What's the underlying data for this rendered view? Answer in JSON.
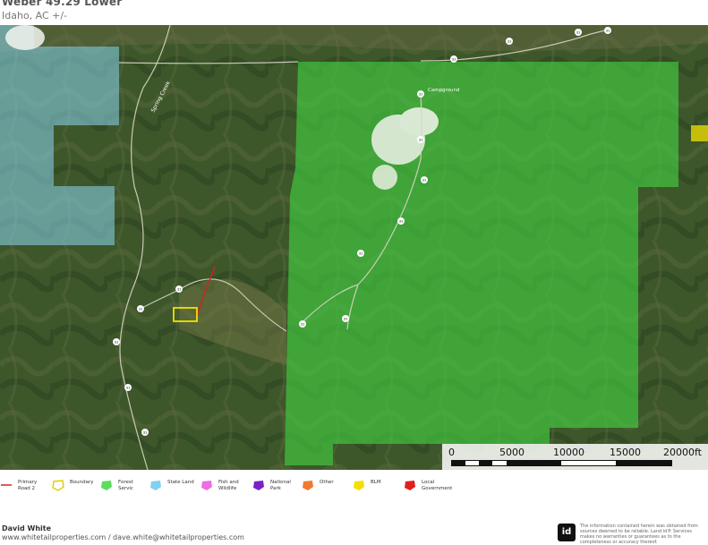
{
  "header": {
    "title": "Weber 49.29 Lower",
    "subtitle": "Idaho,  AC +/-"
  },
  "map": {
    "road_label": "Spring Creek",
    "place_label": "Campground",
    "route_shields": [
      "31",
      "31",
      "31",
      "31",
      "31",
      "31",
      "31",
      "31",
      "31",
      "31",
      "31",
      "31",
      "31",
      "31",
      "31",
      "31"
    ],
    "colors": {
      "forest_service": "#42d442",
      "state_land": "#8ad6f0",
      "boundary": "#f2e200",
      "primary_road": "#d62020",
      "blm": "#f5e000"
    }
  },
  "scale": {
    "labels": [
      "0",
      "5000",
      "10000",
      "15000",
      "20000ft"
    ]
  },
  "legend": [
    {
      "key": "primary-road",
      "label": "Primary Road 2",
      "symbol": "line",
      "color": "#d62020"
    },
    {
      "key": "boundary",
      "label": "Boundary",
      "symbol": "outline",
      "color": "#e6c800"
    },
    {
      "key": "forest-service",
      "label": "Forest Servic",
      "symbol": "pentagon",
      "color": "#5ddc5d"
    },
    {
      "key": "state-land",
      "label": "State Land",
      "symbol": "pentagon",
      "color": "#7fd1ee"
    },
    {
      "key": "fish-wildlife",
      "label": "Fish and Wildlife",
      "symbol": "pentagon",
      "color": "#f06ee0"
    },
    {
      "key": "national-park",
      "label": "National Park",
      "symbol": "pentagon",
      "color": "#7a22c8"
    },
    {
      "key": "other",
      "label": "Other",
      "symbol": "pentagon",
      "color": "#f07a30"
    },
    {
      "key": "blm",
      "label": "BLM",
      "symbol": "pentagon",
      "color": "#f5e000"
    },
    {
      "key": "local-government",
      "label": "Local Government",
      "symbol": "pentagon",
      "color": "#e02020"
    }
  ],
  "footer": {
    "name": "David White",
    "contact": "www.whitetailproperties.com / dave.white@whitetailproperties.com",
    "logo": "id",
    "disclaimer": "The information contained herein was obtained from sources deemed to be reliable. Land id® Services makes no warranties or guarantees as to the completeness or accuracy thereof."
  }
}
